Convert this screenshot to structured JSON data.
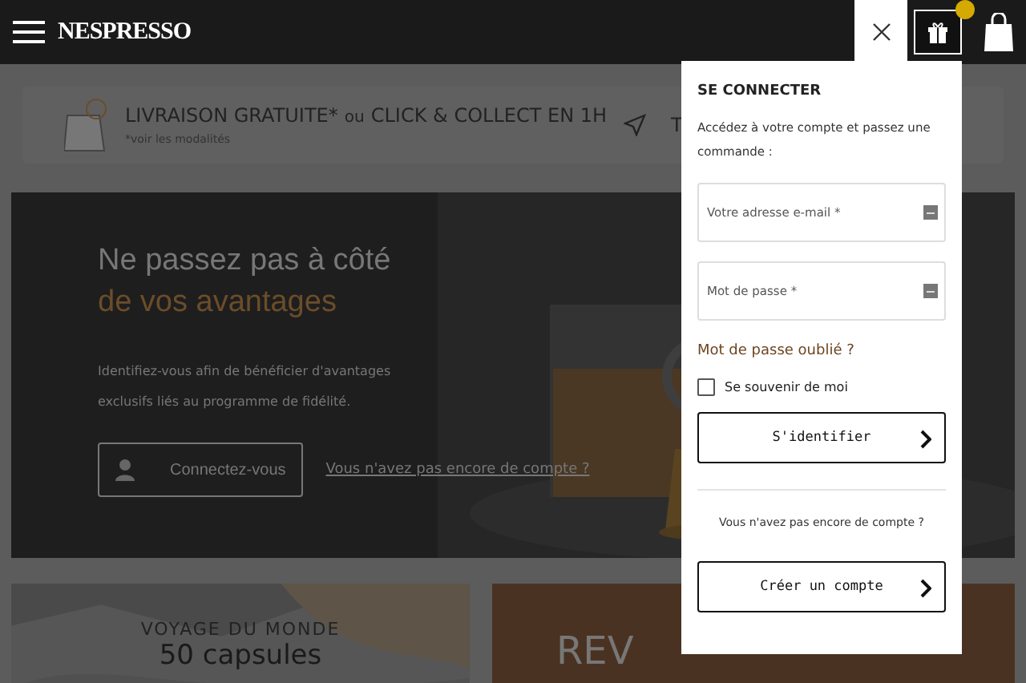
{
  "header": {
    "logo": "NESPRESSO",
    "gift_badge": true
  },
  "banner": {
    "title_left": "LIVRAISON GRATUITE*",
    "title_mid": "ou",
    "title_right": "CLICK & COLLECT EN 1H",
    "note": "*voir les modalités",
    "cut_text": "T"
  },
  "hero": {
    "title_line1": "Ne passez pas à côté",
    "title_line2": "de vos avantages",
    "text": "Identifiez-vous afin de bénéficier d'avantages exclusifs liés au programme de fidélité.",
    "button": "Connectez-vous",
    "link": "Vous n'avez pas encore de compte ?"
  },
  "cards": [
    {
      "kind": "picture",
      "kicker": "VOYAGE DU MONDE",
      "title": "50 capsules"
    },
    {
      "kind": "plain",
      "title": "REV"
    }
  ],
  "login": {
    "title": "SE CONNECTER",
    "intro": "Accédez à votre compte et passez une commande :",
    "fields": [
      {
        "placeholder": "Votre adresse e-mail *"
      },
      {
        "placeholder": "Mot de passe *"
      }
    ],
    "forgot": "Mot de passe oublié ?",
    "remember": {
      "label": "Se souvenir de moi",
      "checked": false
    },
    "submit": "S'identifier",
    "no_account": "Vous n'avez pas encore de compte ?",
    "create": "Créer un compte"
  }
}
